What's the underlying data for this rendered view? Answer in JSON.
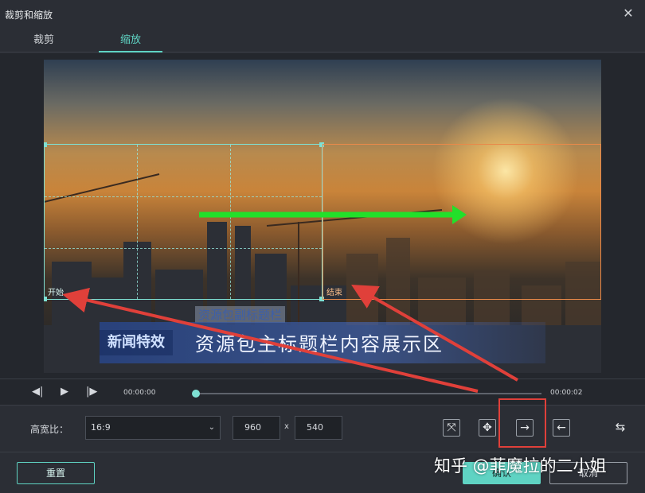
{
  "window": {
    "title": "裁剪和缩放",
    "close_glyph": "✕"
  },
  "tabs": [
    {
      "label": "裁剪",
      "active": false
    },
    {
      "label": "缩放",
      "active": true
    }
  ],
  "preview": {
    "start_label": "开始",
    "end_label": "结束",
    "lower_third": {
      "logo_text": "新闻特效",
      "main_text": "资源包主标题栏内容展示区",
      "sub_text": "资源包副标题栏"
    }
  },
  "playback": {
    "current_time": "00:00:00",
    "total_time": "00:00:02",
    "progress": 0.0,
    "icons": [
      "step-back-icon",
      "play-icon",
      "step-forward-icon"
    ]
  },
  "settings": {
    "aspect_label": "高宽比：",
    "aspect_value": "16:9",
    "width": "960",
    "times": "x",
    "height": "540",
    "icons": [
      "fit-icon",
      "move-icon",
      "arrow-right-icon",
      "arrow-left-icon",
      "swap-icon"
    ]
  },
  "footer": {
    "reset_label": "重置",
    "ok_label": "确认",
    "cancel_label": "取消"
  },
  "watermark": "知乎 @菲魔拉的二小姐",
  "colors": {
    "accent": "#5fd3c3",
    "end_box": "#e8894a",
    "annotation": "#e0403a",
    "motion_arrow": "#22e02a"
  }
}
